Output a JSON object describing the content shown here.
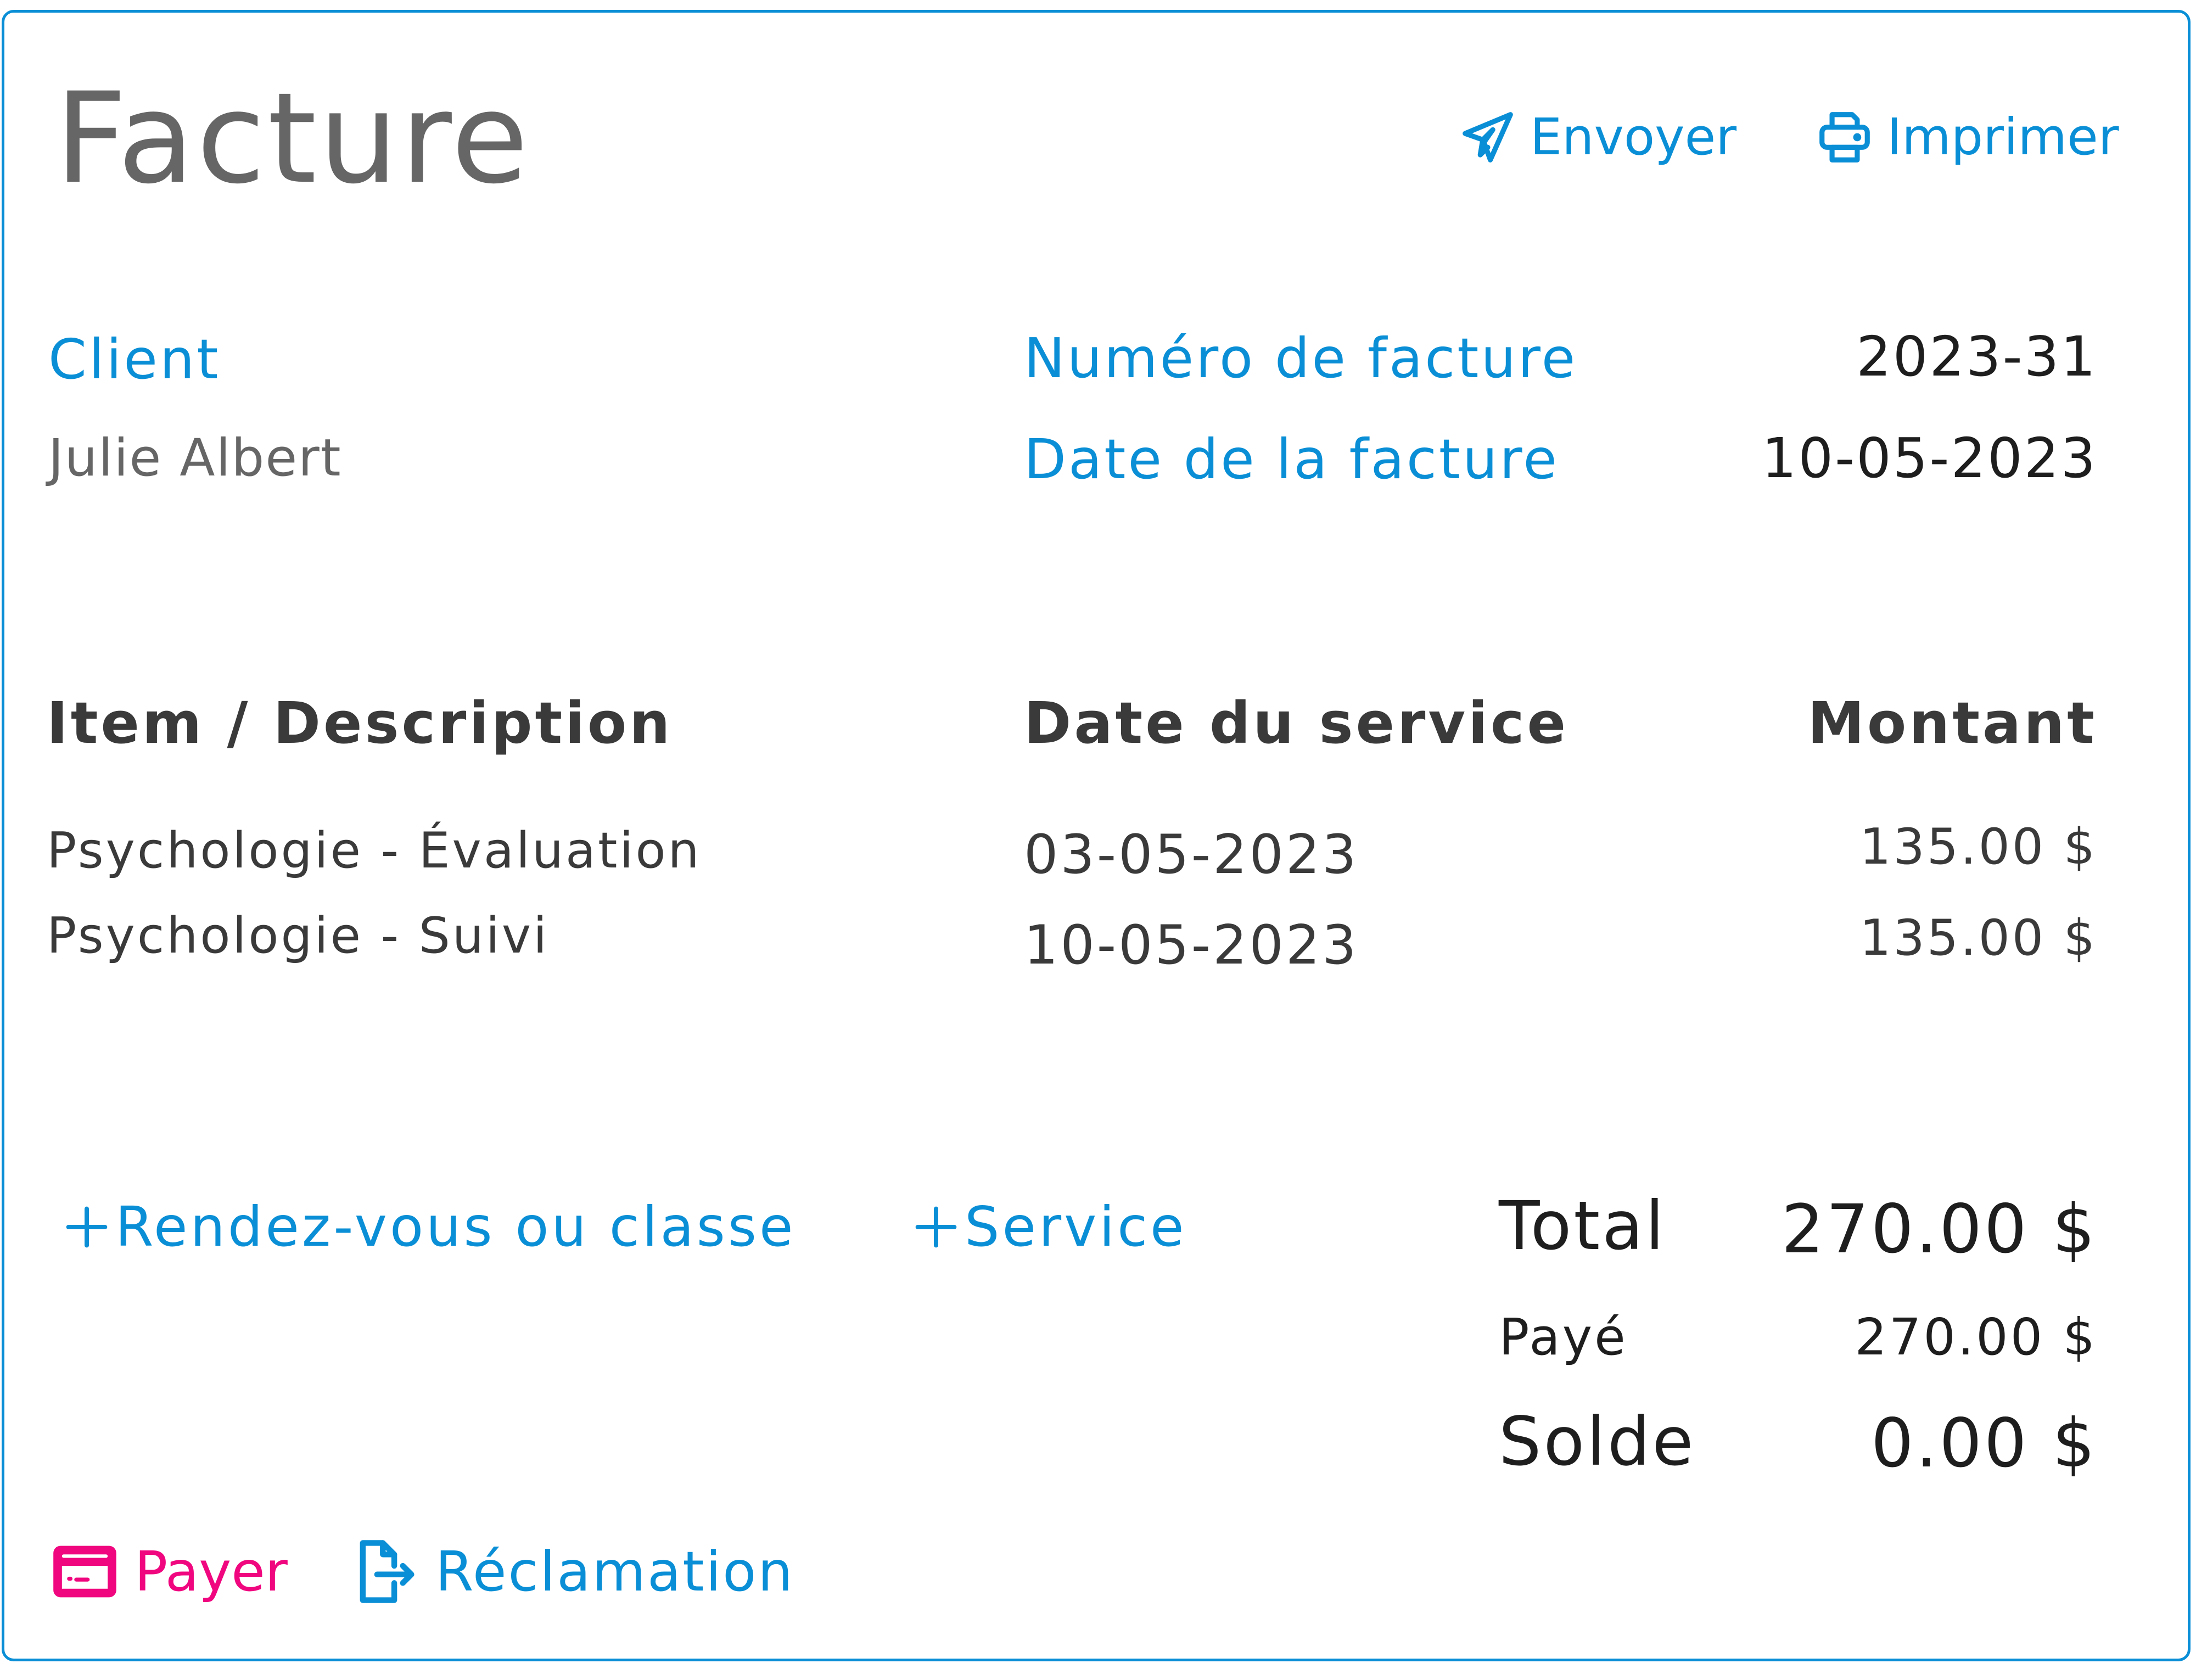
{
  "header": {
    "title": "Facture",
    "actions": [
      {
        "label": "Envoyer",
        "icon": "paper-plane-icon"
      },
      {
        "label": "Imprimer",
        "icon": "printer-icon"
      }
    ]
  },
  "client": {
    "label": "Client",
    "name": "Julie Albert"
  },
  "invoice_meta": {
    "number_label": "Numéro de facture",
    "number_value": "2023-31",
    "date_label": "Date de la facture",
    "date_value": "10-05-2023"
  },
  "table": {
    "columns": [
      "Item / Description",
      "Date du service",
      "Montant"
    ],
    "rows": [
      {
        "description": "Psychologie - Évaluation",
        "date": "03-05-2023",
        "amount": "135.00 $"
      },
      {
        "description": "Psychologie - Suivi",
        "date": "10-05-2023",
        "amount": "135.00 $"
      }
    ]
  },
  "add_actions": [
    {
      "label": "Rendez-vous ou classe",
      "icon": "plus-icon"
    },
    {
      "label": "Service",
      "icon": "plus-icon"
    }
  ],
  "summary": {
    "total_label": "Total",
    "total_value": "270.00 $",
    "paid_label": "Payé",
    "paid_value": "270.00 $",
    "balance_label": "Solde",
    "balance_value": "0.00 $"
  },
  "footer_actions": [
    {
      "label": "Payer",
      "icon": "credit-card-icon"
    },
    {
      "label": "Réclamation",
      "icon": "file-export-icon"
    }
  ],
  "colors": {
    "accent": "#0a8fd6",
    "pay": "#f0067f",
    "title": "#666666",
    "text": "#3a3a3a",
    "strong_text": "#1e1e1e"
  }
}
